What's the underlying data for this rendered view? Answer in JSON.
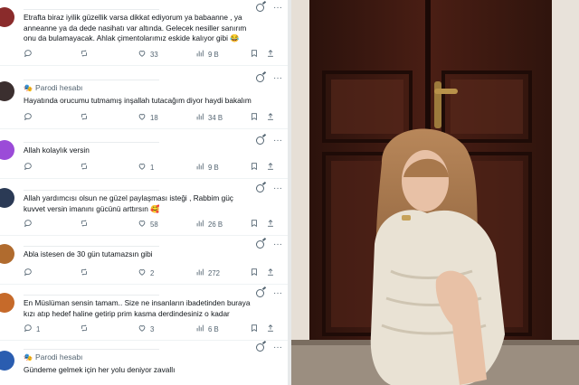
{
  "replies": [
    {
      "text": "Etrafta biraz iyilik güzellik varsa dikkat ediyorum ya babaanne , ya anneanne ya da dede nasihatı var altında. Gelecek nesiller sanırım onu da bulamayacak. Ahlak çimentolarımız eskide kalıyor gibi 😂",
      "parody": "",
      "replies": "",
      "reposts": "",
      "likes": "33",
      "views": "9 B",
      "avatar_color": "#8a2b2b"
    },
    {
      "text": "Hayatında orucumu tutmamış inşallah tutacağım diyor haydi bakalım",
      "parody": "Parodi hesabı",
      "replies": "",
      "reposts": "",
      "likes": "18",
      "views": "34 B",
      "avatar_color": "#3b2f2f"
    },
    {
      "text": "Allah kolaylık versin",
      "parody": "",
      "replies": "",
      "reposts": "",
      "likes": "1",
      "views": "9 B",
      "avatar_color": "#9b4bd8"
    },
    {
      "text": "Allah yardımcısı olsun ne güzel paylaşması isteği , Rabbim güç kuvvet versin imanını gücünü arttırsın 🥰",
      "parody": "",
      "replies": "",
      "reposts": "",
      "likes": "58",
      "views": "26 B",
      "avatar_color": "#2b3a55"
    },
    {
      "text": "Abla istesen de 30 gün tutamazsın gibi",
      "parody": "",
      "replies": "",
      "reposts": "",
      "likes": "2",
      "views": "272",
      "avatar_color": "#b06b2e"
    },
    {
      "text": "En Müslüman sensin tamam.. Size ne insanların ibadetinden buraya kızı atıp hedef haline getirip prim kasma derdindesiniz o kadar",
      "parody": "",
      "replies": "1",
      "reposts": "",
      "likes": "3",
      "views": "6 B",
      "avatar_color": "#c66a2a"
    },
    {
      "text": "Gündeme gelmek için her yolu deniyor zavallı",
      "parody": "Parodi hesabı",
      "replies": "",
      "reposts": "",
      "likes": "",
      "views": "",
      "avatar_color": "#2a5db0"
    }
  ],
  "icons": {
    "reply": "comment-icon",
    "repost": "repost-icon",
    "like": "heart-icon",
    "views": "bar-chart-icon",
    "bookmark": "bookmark-icon",
    "share": "share-icon",
    "grok": "grok-icon",
    "more": "more-icon",
    "parody": "theater-masks-icon"
  },
  "more_glyph": "···",
  "parody_glyph": "🎭"
}
